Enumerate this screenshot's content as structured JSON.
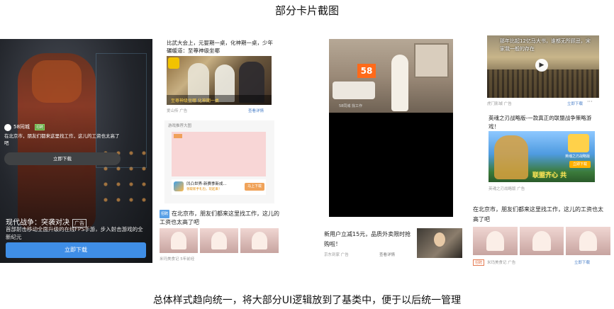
{
  "header": {
    "title": "部分卡片截图"
  },
  "footer": {
    "caption": "总体样式趋向统一，将大部分UI逻辑放到了基类中，便于以后统一管理"
  },
  "card_game_dark": {
    "title": "现代战争：突袭对决",
    "ad_tag": "广告",
    "desc": "首部射击移动全面升级的在线FPS手游，步入射击游戏的全新纪元",
    "button": "立即下载"
  },
  "card_martial": {
    "text": "比武大会上，元婴期一桌，化神期一桌，少年碾缓道：至尊神级坐哪",
    "caption": "至尊神级坐哪 化神期一桌",
    "meta": "爱山传 广告",
    "link": "查看详情"
  },
  "card_game_pink": {
    "header": "游戏推荐大图",
    "tag": "活动",
    "app_name": "凹凸世界-新赛季新成...",
    "app_sub": "领取新手礼包，玩起来！",
    "button": "马上下载"
  },
  "card_58_a": {
    "tag": "招聘",
    "text": "在北京市，朋友们都来这里找工作，这儿的工资也太高了吧",
    "meta": "米玛美食记 5年前经"
  },
  "card_video_58": {
    "logo": "58",
    "caption": "58同城 找工作",
    "brand": "58同城",
    "brand_tag": "招聘",
    "desc": "在北京市，朋友们都来这里找工作，这儿的工资也太高了吧",
    "button": "立即下载"
  },
  "card_jd": {
    "text": "新用户立减15元，品质外卖限时抢购啦！",
    "meta": "京东到家 广告",
    "link": "查看详情"
  },
  "card_battle": {
    "caption": "那年比起12亿马大书，谁都无所顾忌，宋家我一般的存在",
    "meta": "虎门影城 广告",
    "link": "立即下载",
    "dots": "···"
  },
  "card_yinghun": {
    "text": "英魂之刃战略版-一款真正的联盟战争策略游戏！",
    "slogan": "联盟齐心 共",
    "logo_text": "英魂之刃战略版",
    "button": "立即下载",
    "meta": "英魂之刃战略版 广告"
  },
  "card_58_b": {
    "text": "在北京市，朋友们都来这里找工作，这儿的工资也太高了吧",
    "tag": "招聘",
    "meta": "米玛美食记 广告",
    "link": "立即下载"
  }
}
